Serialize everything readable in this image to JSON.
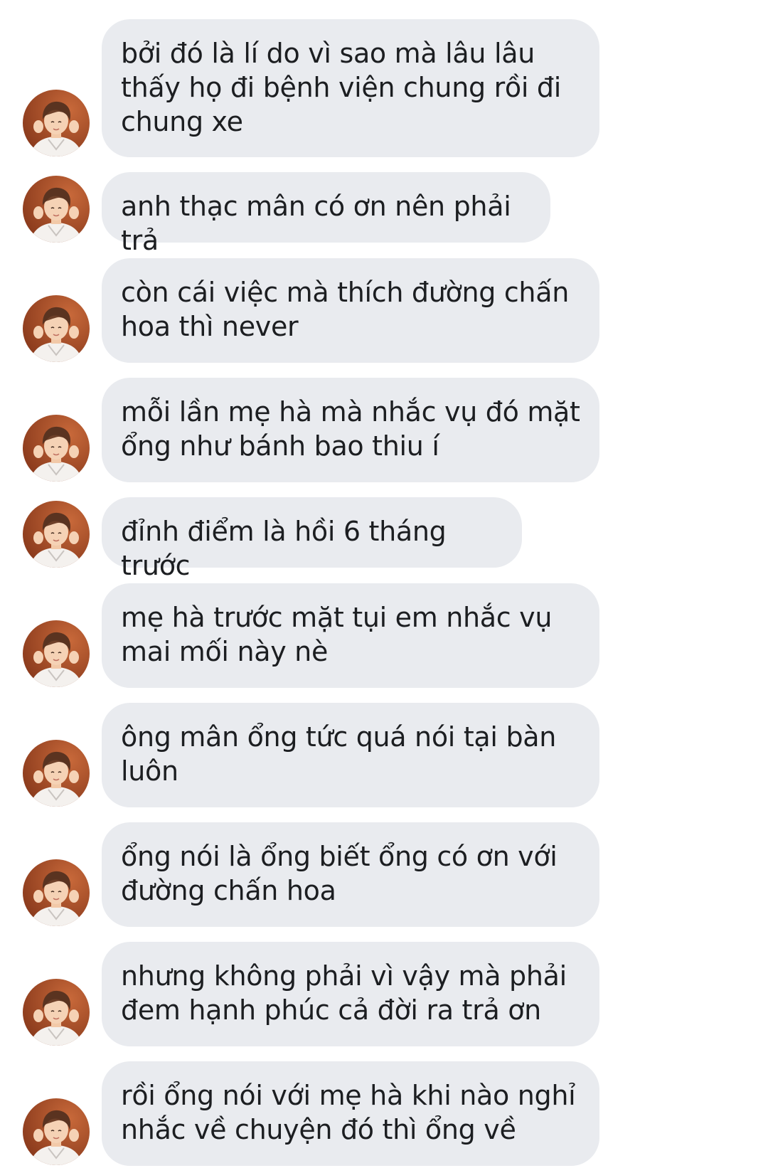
{
  "thread": {
    "messages": [
      {
        "text": "bởi đó là lí do vì sao mà lâu lâu thấy họ đi bệnh viện chung rồi đi chung xe",
        "avatar_icon": "user-avatar"
      },
      {
        "text": "anh thạc mân có ơn nên phải trả",
        "avatar_icon": "user-avatar"
      },
      {
        "text": "còn cái việc mà thích đường chấn hoa thì never",
        "avatar_icon": "user-avatar"
      },
      {
        "text": "mỗi lần mẹ hà mà nhắc vụ đó mặt ổng như bánh bao thiu í",
        "avatar_icon": "user-avatar"
      },
      {
        "text": "đỉnh điểm là hồi 6 tháng trước",
        "avatar_icon": "user-avatar"
      },
      {
        "text": "mẹ hà trước mặt tụi em nhắc vụ mai mối này nè",
        "avatar_icon": "user-avatar"
      },
      {
        "text": "ông mân ổng tức quá nói tại bàn luôn",
        "avatar_icon": "user-avatar"
      },
      {
        "text": "ổng nói là ổng biết ổng có ơn với đường chấn hoa",
        "avatar_icon": "user-avatar"
      },
      {
        "text": "nhưng không phải vì vậy mà phải đem hạnh phúc cả đời ra trả ơn",
        "avatar_icon": "user-avatar"
      },
      {
        "text": "rồi ổng nói với mẹ hà khi nào nghỉ nhắc về chuyện đó thì ổng về",
        "avatar_icon": "user-avatar"
      }
    ]
  },
  "colors": {
    "bubble_bg": "#e9ebef",
    "text": "#1c1e21",
    "avatar_bg": "#b5552b"
  }
}
